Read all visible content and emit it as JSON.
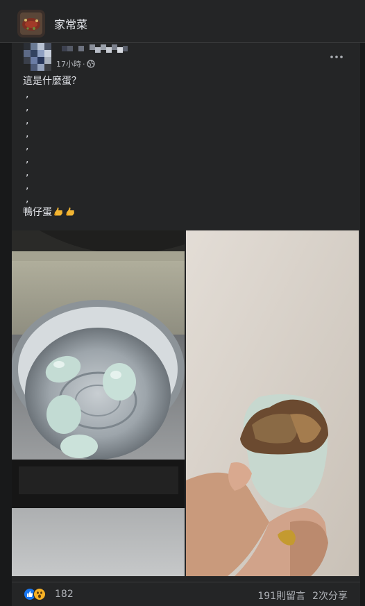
{
  "group": {
    "name": "家常菜",
    "avatar_icon": "group-avatar-image"
  },
  "post": {
    "timestamp": "17小時",
    "separator": "·",
    "privacy_icon": "globe-icon",
    "more_icon": "more-horizontal-icon",
    "lines": [
      "這是什麼蛋？",
      ",",
      ",",
      ",",
      ",",
      ",",
      ",",
      ",",
      ",",
      ",",
      "鴨仔蛋"
    ],
    "emoji": [
      "call-me-hand-emoji",
      "call-me-hand-emoji"
    ]
  },
  "photos": [
    {
      "alt_icon": "eggs-in-pot-photo"
    },
    {
      "alt_icon": "balut-egg-in-hand-photo"
    }
  ],
  "reactions": {
    "icons": [
      "like-reaction-icon",
      "wow-reaction-icon"
    ],
    "count": "182",
    "comments": "191則留言",
    "shares": "2次分享"
  }
}
